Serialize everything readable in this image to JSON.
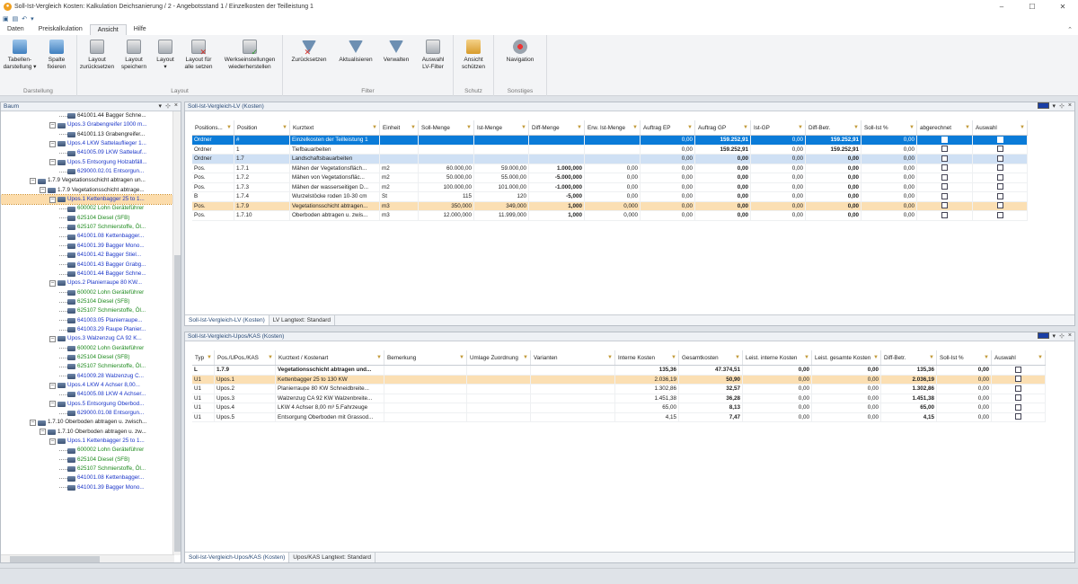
{
  "window": {
    "title": "Soll-Ist-Vergleich Kosten: Kalkulation Deichsanierung / 2 - Angebotsstand 1 / Einzelkosten der Teilleistung 1",
    "controls": [
      "–",
      "☐",
      "✕"
    ]
  },
  "ribbon": {
    "tabs": [
      {
        "label": "Daten"
      },
      {
        "label": "Preiskalkulation"
      },
      {
        "label": "Ansicht",
        "active": true
      },
      {
        "label": "Hilfe"
      }
    ],
    "groups": [
      {
        "label": "Darstellung",
        "buttons": [
          {
            "label": "Tabellen-\ndarstellung ▾",
            "icon": "table-view-icon"
          },
          {
            "label": "Spalte\nfixieren",
            "icon": "pin-column-icon"
          }
        ]
      },
      {
        "label": "Layout",
        "buttons": [
          {
            "label": "Layout\nzurücksetzen",
            "icon": "layout-reset-icon"
          },
          {
            "label": "Layout\nspeichern",
            "icon": "layout-save-icon"
          },
          {
            "label": "Layout\n▾",
            "icon": "layout-icon"
          },
          {
            "label": "Layout für\nalle setzen",
            "icon": "layout-all-icon"
          },
          {
            "label": "Werkseinstellungen\nwiederherstellen",
            "icon": "factory-reset-icon"
          }
        ]
      },
      {
        "label": "Filter",
        "buttons": [
          {
            "label": "Zurücksetzen",
            "icon": "filter-reset-icon"
          },
          {
            "label": "Aktualisieren",
            "icon": "filter-refresh-icon"
          },
          {
            "label": "Verwalten",
            "icon": "filter-manage-icon"
          },
          {
            "label": "Auswahl\nLV-Filter",
            "icon": "filter-select-icon"
          }
        ]
      },
      {
        "label": "Schutz",
        "buttons": [
          {
            "label": "Ansicht\nschützen",
            "icon": "lock-icon"
          }
        ]
      },
      {
        "label": "Sonstiges",
        "buttons": [
          {
            "label": "Navigation",
            "icon": "navigation-icon"
          }
        ]
      }
    ]
  },
  "tree_panel": {
    "title": "Baum",
    "nodes": [
      {
        "indent": 5,
        "icon": "item",
        "color": "black",
        "text": "641001.44  Bagger  Schne..."
      },
      {
        "indent": 4,
        "icon": "folder",
        "color": "blue",
        "text": "Upos.3  Grabengreifer 1000 m..."
      },
      {
        "indent": 5,
        "icon": "item",
        "color": "black",
        "text": "641001.13  Grabengreifer..."
      },
      {
        "indent": 4,
        "icon": "folder",
        "color": "blue",
        "text": "Upos.4  LKW Sattelauflieger 1..."
      },
      {
        "indent": 5,
        "icon": "item",
        "color": "blue",
        "text": "641005.09  LKW Sattelauf..."
      },
      {
        "indent": 4,
        "icon": "folder",
        "color": "blue",
        "text": "Upos.5  Entsorgung Holzabfäll..."
      },
      {
        "indent": 5,
        "icon": "item",
        "color": "blue",
        "text": "629000.02.01  Entsorgun..."
      },
      {
        "indent": 2,
        "icon": "folder",
        "color": "black",
        "text": "1.7.9  Vegetationsschicht  abtragen  un..."
      },
      {
        "indent": 3,
        "icon": "folder",
        "color": "black",
        "text": "1.7.9  Vegetationsschicht  abtrage..."
      },
      {
        "indent": 4,
        "icon": "folder",
        "color": "blue",
        "text": "Upos.1  Kettenbagger 25 to 1...",
        "selected": true
      },
      {
        "indent": 5,
        "icon": "item",
        "color": "green",
        "text": "600002  Lohn Geräteführer"
      },
      {
        "indent": 5,
        "icon": "item",
        "color": "green",
        "text": "625104  Diesel (SFB)"
      },
      {
        "indent": 5,
        "icon": "item",
        "color": "green",
        "text": "625107  Schmierstoffe,  Öl..."
      },
      {
        "indent": 5,
        "icon": "item",
        "color": "blue",
        "text": "641001.08  Kettenbagger..."
      },
      {
        "indent": 5,
        "icon": "item",
        "color": "blue",
        "text": "641001.39  Bagger  Mono..."
      },
      {
        "indent": 5,
        "icon": "item",
        "color": "blue",
        "text": "641001.42  Bagger  Stiel..."
      },
      {
        "indent": 5,
        "icon": "item",
        "color": "blue",
        "text": "641001.43  Bagger  Grabg..."
      },
      {
        "indent": 5,
        "icon": "item",
        "color": "blue",
        "text": "641001.44  Bagger  Schne..."
      },
      {
        "indent": 4,
        "icon": "folder",
        "color": "blue",
        "text": "Upos.2  Planierraupe  80 KW..."
      },
      {
        "indent": 5,
        "icon": "item",
        "color": "green",
        "text": "600002  Lohn Geräteführer"
      },
      {
        "indent": 5,
        "icon": "item",
        "color": "green",
        "text": "625104  Diesel (SFB)"
      },
      {
        "indent": 5,
        "icon": "item",
        "color": "green",
        "text": "625107  Schmierstoffe,  Öl..."
      },
      {
        "indent": 5,
        "icon": "item",
        "color": "blue",
        "text": "641003.05  Planierraupe..."
      },
      {
        "indent": 5,
        "icon": "item",
        "color": "blue",
        "text": "641003.29  Raupe  Planier..."
      },
      {
        "indent": 4,
        "icon": "folder",
        "color": "blue",
        "text": "Upos.3  Walzenzug CA   92 K..."
      },
      {
        "indent": 5,
        "icon": "item",
        "color": "green",
        "text": "600002  Lohn Geräteführer"
      },
      {
        "indent": 5,
        "icon": "item",
        "color": "green",
        "text": "625104  Diesel (SFB)"
      },
      {
        "indent": 5,
        "icon": "item",
        "color": "green",
        "text": "625107  Schmierstoffe,  Öl..."
      },
      {
        "indent": 5,
        "icon": "item",
        "color": "blue",
        "text": "641009.28  Walzenzug  C..."
      },
      {
        "indent": 4,
        "icon": "folder",
        "color": "blue",
        "text": "Upos.4  LKW 4 Achser  8,00..."
      },
      {
        "indent": 5,
        "icon": "item",
        "color": "blue",
        "text": "641005.08  LKW 4 Achser..."
      },
      {
        "indent": 4,
        "icon": "folder",
        "color": "blue",
        "text": "Upos.5  Entsorgung  Oberbod..."
      },
      {
        "indent": 5,
        "icon": "item",
        "color": "blue",
        "text": "629000.01.08  Entsorgun..."
      },
      {
        "indent": 2,
        "icon": "folder",
        "color": "black",
        "text": "1.7.10  Oberboden abtragen u. zwisch..."
      },
      {
        "indent": 3,
        "icon": "folder",
        "color": "black",
        "text": "1.7.10  Oberboden abtragen u. zw..."
      },
      {
        "indent": 4,
        "icon": "folder",
        "color": "blue",
        "text": "Upos.1  Kettenbagger 25 to 1..."
      },
      {
        "indent": 5,
        "icon": "item",
        "color": "green",
        "text": "600002  Lohn Geräteführer"
      },
      {
        "indent": 5,
        "icon": "item",
        "color": "green",
        "text": "625104  Diesel (SFB)"
      },
      {
        "indent": 5,
        "icon": "item",
        "color": "green",
        "text": "625107  Schmierstoffe,  Öl..."
      },
      {
        "indent": 5,
        "icon": "item",
        "color": "blue",
        "text": "641001.08  Kettenbagger..."
      },
      {
        "indent": 5,
        "icon": "item",
        "color": "blue",
        "text": "641001.39  Bagger  Mono..."
      }
    ]
  },
  "lv_panel": {
    "title": "Soll-Ist-Vergleich-LV (Kosten)",
    "columns": [
      {
        "label": "Positions...",
        "w": 47
      },
      {
        "label": "Position",
        "w": 62
      },
      {
        "label": "Kurztext",
        "w": 100
      },
      {
        "label": "Einheit",
        "w": 43
      },
      {
        "label": "Soll-Menge",
        "w": 62
      },
      {
        "label": "Ist-Menge",
        "w": 61
      },
      {
        "label": "Diff-Menge",
        "w": 62
      },
      {
        "label": "Erw. Ist-Menge",
        "w": 62
      },
      {
        "label": "Auftrag EP",
        "w": 61
      },
      {
        "label": "Auftrag GP",
        "w": 62
      },
      {
        "label": "Ist-GP",
        "w": 61
      },
      {
        "label": "Diff-Betr.",
        "w": 62
      },
      {
        "label": "Soll-Ist %",
        "w": 62
      },
      {
        "label": "abgerechnet",
        "w": 62
      },
      {
        "label": "Auswahl",
        "w": 61
      }
    ],
    "rows": [
      {
        "style": "blue",
        "cells": [
          "Ordner",
          "#",
          "Einzelkosten der Teilleistung 1",
          "",
          "",
          "",
          "",
          "",
          "0,00",
          "159.252,91",
          "0,00",
          "159.252,91",
          "0,00",
          "",
          ""
        ]
      },
      {
        "style": "",
        "cells": [
          "Ordner",
          "1",
          "Tiefbauarbeiten",
          "",
          "",
          "",
          "",
          "",
          "0,00",
          "159.252,91",
          "0,00",
          "159.252,91",
          "0,00",
          "",
          ""
        ]
      },
      {
        "style": "lblue",
        "cells": [
          "Ordner",
          "1.7",
          "Landschaftsbauarbeiten",
          "",
          "",
          "",
          "",
          "",
          "0,00",
          "0,00",
          "0,00",
          "0,00",
          "0,00",
          "",
          ""
        ]
      },
      {
        "style": "",
        "cells": [
          "Pos.",
          "1.7.1",
          "Mähen der Vegetationsfläch...",
          "m2",
          "60.000,00",
          "59.000,00",
          "1.000,000",
          "0,00",
          "0,00",
          "0,00",
          "0,00",
          "0,00",
          "0,00",
          "",
          ""
        ]
      },
      {
        "style": "",
        "cells": [
          "Pos.",
          "1.7.2",
          "Mähen von Vegetationsfläc...",
          "m2",
          "50.000,00",
          "55.000,00",
          "-5.000,000",
          "0,00",
          "0,00",
          "0,00",
          "0,00",
          "0,00",
          "0,00",
          "",
          ""
        ]
      },
      {
        "style": "",
        "cells": [
          "Pos.",
          "1.7.3",
          "Mähen der wasserseitigen D...",
          "m2",
          "100.000,00",
          "101.000,00",
          "-1.000,000",
          "0,00",
          "0,00",
          "0,00",
          "0,00",
          "0,00",
          "0,00",
          "",
          ""
        ]
      },
      {
        "style": "",
        "cells": [
          "B",
          "1.7.4",
          "Wurzelstöcke roden 10-30 cm",
          "St",
          "115",
          "120",
          "-5,000",
          "0,00",
          "0,00",
          "0,00",
          "0,00",
          "0,00",
          "0,00",
          "",
          ""
        ]
      },
      {
        "style": "orange",
        "cells": [
          "Pos.",
          "1.7.9",
          "Vegetationsschicht abtragen...",
          "m3",
          "350,000",
          "349,000",
          "1,000",
          "0,000",
          "0,00",
          "0,00",
          "0,00",
          "0,00",
          "0,00",
          "",
          ""
        ]
      },
      {
        "style": "",
        "cells": [
          "Pos.",
          "1.7.10",
          "Oberboden abtragen u. zwis...",
          "m3",
          "12.000,000",
          "11.999,000",
          "1,000",
          "0,000",
          "0,00",
          "0,00",
          "0,00",
          "0,00",
          "0,00",
          "",
          ""
        ]
      }
    ],
    "subtabs": [
      "Soll-Ist-Vergleich-LV (Kosten)",
      "LV Langtext: Standard"
    ]
  },
  "upos_panel": {
    "title": "Soll-Ist-Vergleich-Upos/KAS (Kosten)",
    "columns": [
      {
        "label": "Typ",
        "w": 25
      },
      {
        "label": "Pos./UPos./KAS",
        "w": 68
      },
      {
        "label": "Kurztext / Kostenart",
        "w": 121
      },
      {
        "label": "Bemerkung",
        "w": 92
      },
      {
        "label": "Umlage Zuordnung",
        "w": 71
      },
      {
        "label": "Varianten",
        "w": 94
      },
      {
        "label": "Interne Kosten",
        "w": 71
      },
      {
        "label": "Gesamtkosten",
        "w": 71
      },
      {
        "label": "Leist. interne Kosten",
        "w": 77
      },
      {
        "label": "Leist. gesamte Kosten",
        "w": 77
      },
      {
        "label": "Diff-Betr.",
        "w": 62
      },
      {
        "label": "Soll-Ist %",
        "w": 61
      },
      {
        "label": "Auswahl",
        "w": 60
      }
    ],
    "rows": [
      {
        "style": "bold",
        "cells": [
          "L",
          "1.7.9",
          "Vegetationsschicht abtragen und...",
          "",
          "",
          "",
          "135,36",
          "47.374,51",
          "0,00",
          "0,00",
          "135,36",
          "0,00",
          ""
        ]
      },
      {
        "style": "orange",
        "cells": [
          "U1",
          "Upos.1",
          "Kettenbagger 25 to 130 KW",
          "",
          "",
          "",
          "2.036,19",
          "50,90",
          "0,00",
          "0,00",
          "2.036,19",
          "0,00",
          ""
        ]
      },
      {
        "style": "",
        "cells": [
          "U1",
          "Upos.2",
          "Planierraupe  80 KW Schneidbreite...",
          "",
          "",
          "",
          "1.302,86",
          "32,57",
          "0,00",
          "0,00",
          "1.302,86",
          "0,00",
          ""
        ]
      },
      {
        "style": "",
        "cells": [
          "U1",
          "Upos.3",
          "Walzenzug CA   92 KW Walzenbreite...",
          "",
          "",
          "",
          "1.451,38",
          "36,28",
          "0,00",
          "0,00",
          "1.451,38",
          "0,00",
          ""
        ]
      },
      {
        "style": "",
        "cells": [
          "U1",
          "Upos.4",
          "LKW 4 Achser  8,00 m³  5.Fahrzeuge",
          "",
          "",
          "",
          "65,00",
          "8,13",
          "0,00",
          "0,00",
          "65,00",
          "0,00",
          ""
        ]
      },
      {
        "style": "",
        "cells": [
          "U1",
          "Upos.5",
          "Entsorgung Oberboden mit Grassod...",
          "",
          "",
          "",
          "4,15",
          "7,47",
          "0,00",
          "0,00",
          "4,15",
          "0,00",
          ""
        ]
      }
    ],
    "subtabs": [
      "Soll-Ist-Vergleich-Upos/KAS (Kosten)",
      "Upos/KAS Langtext: Standard"
    ]
  }
}
